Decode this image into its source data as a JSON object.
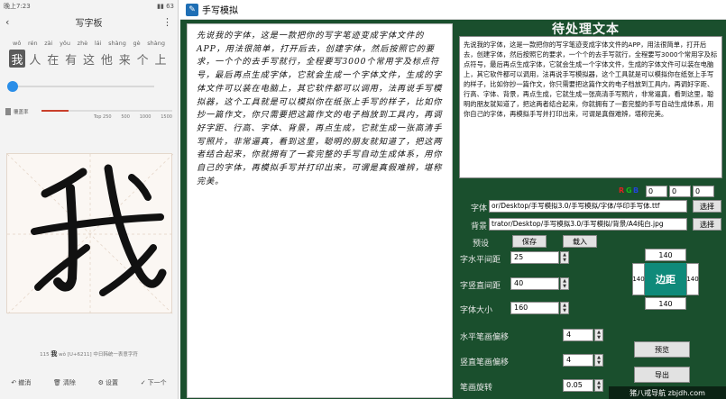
{
  "phone": {
    "status_time": "晚上7:23",
    "status_right": "▮▮ 63",
    "header_title": "写字板",
    "pinyin": [
      "wǒ",
      "rén",
      "zài",
      "yǒu",
      "zhè",
      "lái",
      "shàng",
      "gè",
      "shàng"
    ],
    "hanzi": [
      "我",
      "人",
      "在",
      "有",
      "这",
      "他",
      "来",
      "个",
      "上"
    ],
    "selected_index": 0,
    "rate_label": "覆盖率",
    "rate_ticks": [
      "Top 250",
      "500",
      "1000",
      "1500"
    ],
    "char_index": "115",
    "char_name": "我",
    "char_pinyin": "wǒ",
    "char_code": "[U+6211]",
    "char_source": "中日韩统一表意字符",
    "nav": [
      {
        "icon": "undo-icon",
        "label": "撤消"
      },
      {
        "icon": "trash-icon",
        "label": "清除"
      },
      {
        "icon": "gear-icon",
        "label": "设置"
      },
      {
        "icon": "check-icon",
        "label": "下一个"
      }
    ]
  },
  "window": {
    "title": "手写模拟",
    "paper_text": "先说我的字体，这是一款把你的写字笔迹变成字体文件的APP，用法很简单，打开后去，创建字体，然后按照它的要求，一个个的去手写就行，全程要写3000个常用字及标点符号，最后再点生成字体，它就会生成一个字体文件，生成的字体文件可以装在电脑上，其它软件都可以调用，法再说手写模拟器，这个工具就是可以模拟你在纸张上手写的样子，比如你抄一篇作文，你只需要把这篇作文的电子档放到工具内，再调好字距、行高、字体、背景，再点生成，它就生成一张高清手写照片，非常逼真，看到这里，聪明的朋友就知道了，把这两者结合起来，你就拥有了一套完整的手写自动生成体系，用你自己的字体，再模拟手写并打印出来，可谓是真假难辨，堪称完美。",
    "side_title": "待处理文本",
    "pending_text": "先说我的字体，这是一款把你的写字笔迹变成字体文件的APP，用法很简单，打开后去，创建字体，然后按照它的要求，一个个的去手写就行，全程要写3000个常用字及标点符号，最后再点生成字体，它就会生成一个字体文件，生成的字体文件可以装在电脑上，其它软件都可以调用，法再说手写模拟器，这个工具就是可以模拟你在纸张上手写的样子，比如你抄一篇作文，你只需要把这篇作文的电子档放到工具内，再调好字距、行高、字体、背景，再点生成，它就生成一张高清手写照片，非常逼真，看到这里，聪明的朋友就知道了，把这两者结合起来，你就拥有了一套完整的手写自动生成体系，用你自己的字体，再模拟手写并打印出来，可谓是真假难辨，堪称完美。",
    "rgb": {
      "r": "R",
      "g": "G",
      "b": "B",
      "r_val": "0",
      "g_val": "0",
      "b_val": "0",
      "r_color": "#e02020",
      "g_color": "#18b818",
      "b_color": "#2244dd"
    },
    "font_label": "字体",
    "font_path": "or/Desktop/手写模拟3.0/手写模拟/字体/华印手写体.ttf",
    "bg_label": "背景",
    "bg_path": "trator/Desktop/手写模拟3.0/手写模拟/背景/A4纯白.jpg",
    "select_label": "选择",
    "preset_label": "预设",
    "save_label": "保存",
    "load_label": "载入",
    "h_spacing_label": "字水平间距",
    "h_spacing_value": "25",
    "v_spacing_label": "字竖直间距",
    "v_spacing_value": "40",
    "font_size_label": "字体大小",
    "font_size_value": "160",
    "margin_title": "边距",
    "margin_top": "140",
    "margin_left": "140",
    "margin_right": "140",
    "margin_bottom": "140",
    "h_offset_label": "水平笔画偏移",
    "h_offset_value": "4",
    "v_offset_label": "竖直笔画偏移",
    "v_offset_value": "4",
    "rotate_label": "笔画旋转",
    "rotate_value": "0.05",
    "preview_label": "预览",
    "export_label": "导出",
    "accent": "#1a4f2d"
  },
  "watermark": "猪八戒导航 zbjdh.com"
}
